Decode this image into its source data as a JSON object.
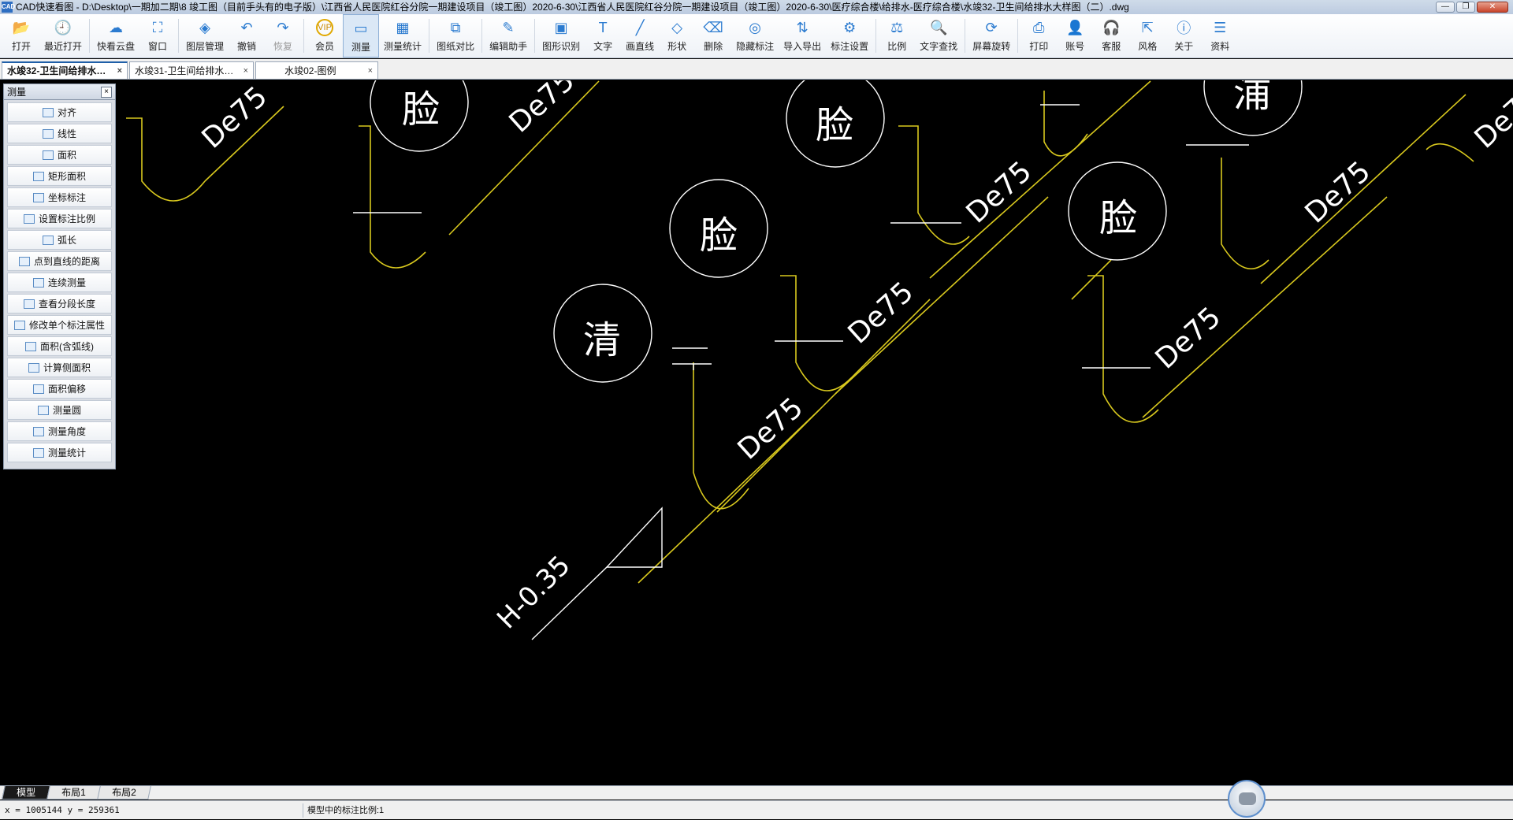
{
  "window": {
    "app_icon_text": "CAD",
    "title": "CAD快速看图 - D:\\Desktop\\一期加二期\\8 竣工图（目前手头有的电子版）\\江西省人民医院红谷分院一期建设项目（竣工图）2020-6-30\\江西省人民医院红谷分院一期建设项目（竣工图）2020-6-30\\医疗综合楼\\给排水-医疗综合楼\\水竣32-卫生间给排水大样图（二）.dwg",
    "btn_min": "—",
    "btn_max": "❐",
    "btn_close": "✕"
  },
  "toolbar": [
    {
      "label": "打开",
      "icon": "📂"
    },
    {
      "label": "最近打开",
      "icon": "🕘"
    },
    {
      "label": "快看云盘",
      "icon": "☁"
    },
    {
      "label": "窗口",
      "icon": "⛶"
    },
    {
      "label": "图层管理",
      "icon": "◈"
    },
    {
      "label": "撤销",
      "icon": "↶"
    },
    {
      "label": "恢复",
      "icon": "↷"
    },
    {
      "label": "会员",
      "icon": "VIP"
    },
    {
      "label": "测量",
      "icon": "▭"
    },
    {
      "label": "测量统计",
      "icon": "▦"
    },
    {
      "label": "图纸对比",
      "icon": "⧉"
    },
    {
      "label": "编辑助手",
      "icon": "✎"
    },
    {
      "label": "图形识别",
      "icon": "▣"
    },
    {
      "label": "文字",
      "icon": "T"
    },
    {
      "label": "画直线",
      "icon": "╱"
    },
    {
      "label": "形状",
      "icon": "◇"
    },
    {
      "label": "删除",
      "icon": "⌫"
    },
    {
      "label": "隐藏标注",
      "icon": "◎"
    },
    {
      "label": "导入导出",
      "icon": "⇅"
    },
    {
      "label": "标注设置",
      "icon": "⚙"
    },
    {
      "label": "比例",
      "icon": "⚖"
    },
    {
      "label": "文字查找",
      "icon": "🔍"
    },
    {
      "label": "屏幕旋转",
      "icon": "⟳"
    },
    {
      "label": "打印",
      "icon": "⎙"
    },
    {
      "label": "账号",
      "icon": "👤"
    },
    {
      "label": "客服",
      "icon": "🎧"
    },
    {
      "label": "风格",
      "icon": "⇱"
    },
    {
      "label": "关于",
      "icon": "ⓘ"
    },
    {
      "label": "资料",
      "icon": "☰"
    }
  ],
  "tabs": [
    {
      "label": "水竣32-卫生间给排水…",
      "close": "×"
    },
    {
      "label": "水竣31-卫生间给排水…",
      "close": "×"
    },
    {
      "label": "水竣02-图例",
      "close": "×"
    }
  ],
  "measure_panel": {
    "title": "测量",
    "close": "×",
    "items": [
      "对齐",
      "线性",
      "面积",
      "矩形面积",
      "坐标标注",
      "设置标注比例",
      "弧长",
      "点到直线的距离",
      "连续测量",
      "查看分段长度",
      "修改单个标注属性",
      "面积(含弧线)",
      "计算侧面积",
      "面积偏移",
      "测量圆",
      "测量角度",
      "测量统计"
    ]
  },
  "drawing": {
    "circle_labels": [
      "脸",
      "脸",
      "脸",
      "脸",
      "清",
      "浦"
    ],
    "pipe_label": "De75",
    "slope_label": "H-0.35"
  },
  "layout_tabs": [
    "模型",
    "布局1",
    "布局2"
  ],
  "status": {
    "coords": "x = 1005144  y = 259361",
    "scale_text": "模型中的标注比例:1"
  },
  "colors": {
    "pipe": "#d8c81e",
    "outline": "#ffffff",
    "canvas": "#000000"
  }
}
